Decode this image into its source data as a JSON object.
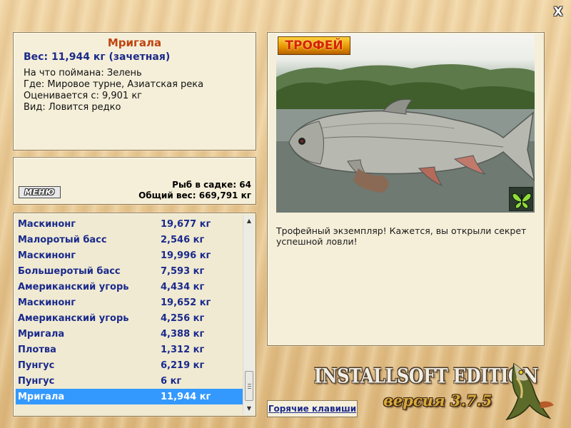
{
  "close_button": "X",
  "info": {
    "fish_name": "Мригала",
    "weight_line": "Вес: 11,944 кг (зачетная)",
    "bait_line": "На что поймана: Зелень",
    "location_line": "Где: Мировое турне, Азиатская река",
    "valued_line": "Оценивается с: 9,901 кг",
    "rarity_line": "Вид: Ловится редко"
  },
  "summary": {
    "menu_label": "МЕНЮ",
    "fish_count_line": "Рыб в садке: 64",
    "total_weight_line": "Общий вес: 669,791 кг"
  },
  "catch_list": [
    {
      "name": "Маскинонг",
      "weight": "19,677 кг"
    },
    {
      "name": "Малоротый басс",
      "weight": "2,546 кг"
    },
    {
      "name": "Маскинонг",
      "weight": "19,996 кг"
    },
    {
      "name": "Большеротый басс",
      "weight": "7,593 кг"
    },
    {
      "name": "Американский угорь",
      "weight": "4,434 кг"
    },
    {
      "name": "Маскинонг",
      "weight": "19,652 кг"
    },
    {
      "name": "Американский угорь",
      "weight": "4,256 кг"
    },
    {
      "name": "Мригала",
      "weight": "4,388 кг"
    },
    {
      "name": "Плотва",
      "weight": "1,312 кг"
    },
    {
      "name": "Пунгус",
      "weight": "6,219 кг"
    },
    {
      "name": "Пунгус",
      "weight": "6 кг"
    },
    {
      "name": "Мригала",
      "weight": "11,944 кг"
    }
  ],
  "selected_index": 11,
  "trophy": {
    "badge": "ТРОФЕЙ",
    "description": "Трофейный экземпляр! Кажется, вы открыли секрет успешной ловли!"
  },
  "hotkeys_label": "Горячие клавиши",
  "edition_text": "INSTALLSOFT EDITION",
  "version_text": "версия 3.7.5",
  "colors": {
    "selection": "#3399ff",
    "list_text": "#1a2a8c",
    "title": "#c0440f"
  },
  "icons": [
    "close-icon",
    "menu-logo",
    "butterfly-icon",
    "pike-fish-icon",
    "scroll-up-icon",
    "scroll-down-icon"
  ]
}
